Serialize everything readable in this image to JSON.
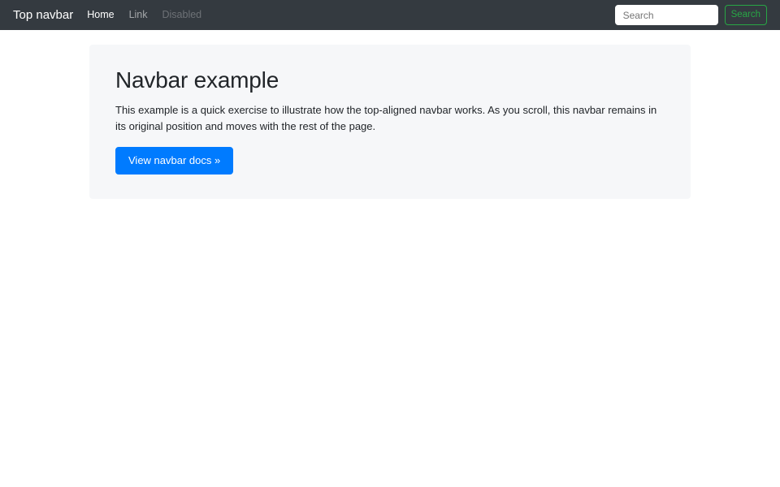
{
  "navbar": {
    "brand": "Top navbar",
    "links": [
      {
        "label": "Home",
        "state": "active"
      },
      {
        "label": "Link",
        "state": "normal"
      },
      {
        "label": "Disabled",
        "state": "disabled"
      }
    ],
    "search": {
      "placeholder": "Search",
      "button_label": "Search"
    }
  },
  "jumbotron": {
    "title": "Navbar example",
    "description": "This example is a quick exercise to illustrate how the top-aligned navbar works. As you scroll, this navbar remains in its original position and moves with the rest of the page.",
    "cta_label": "View navbar docs »"
  },
  "colors": {
    "navbar_background": "#343a40",
    "primary_button": "#007bff",
    "success_outline": "#28a745",
    "panel_background": "#f6f7f9",
    "body_text": "#212529"
  }
}
